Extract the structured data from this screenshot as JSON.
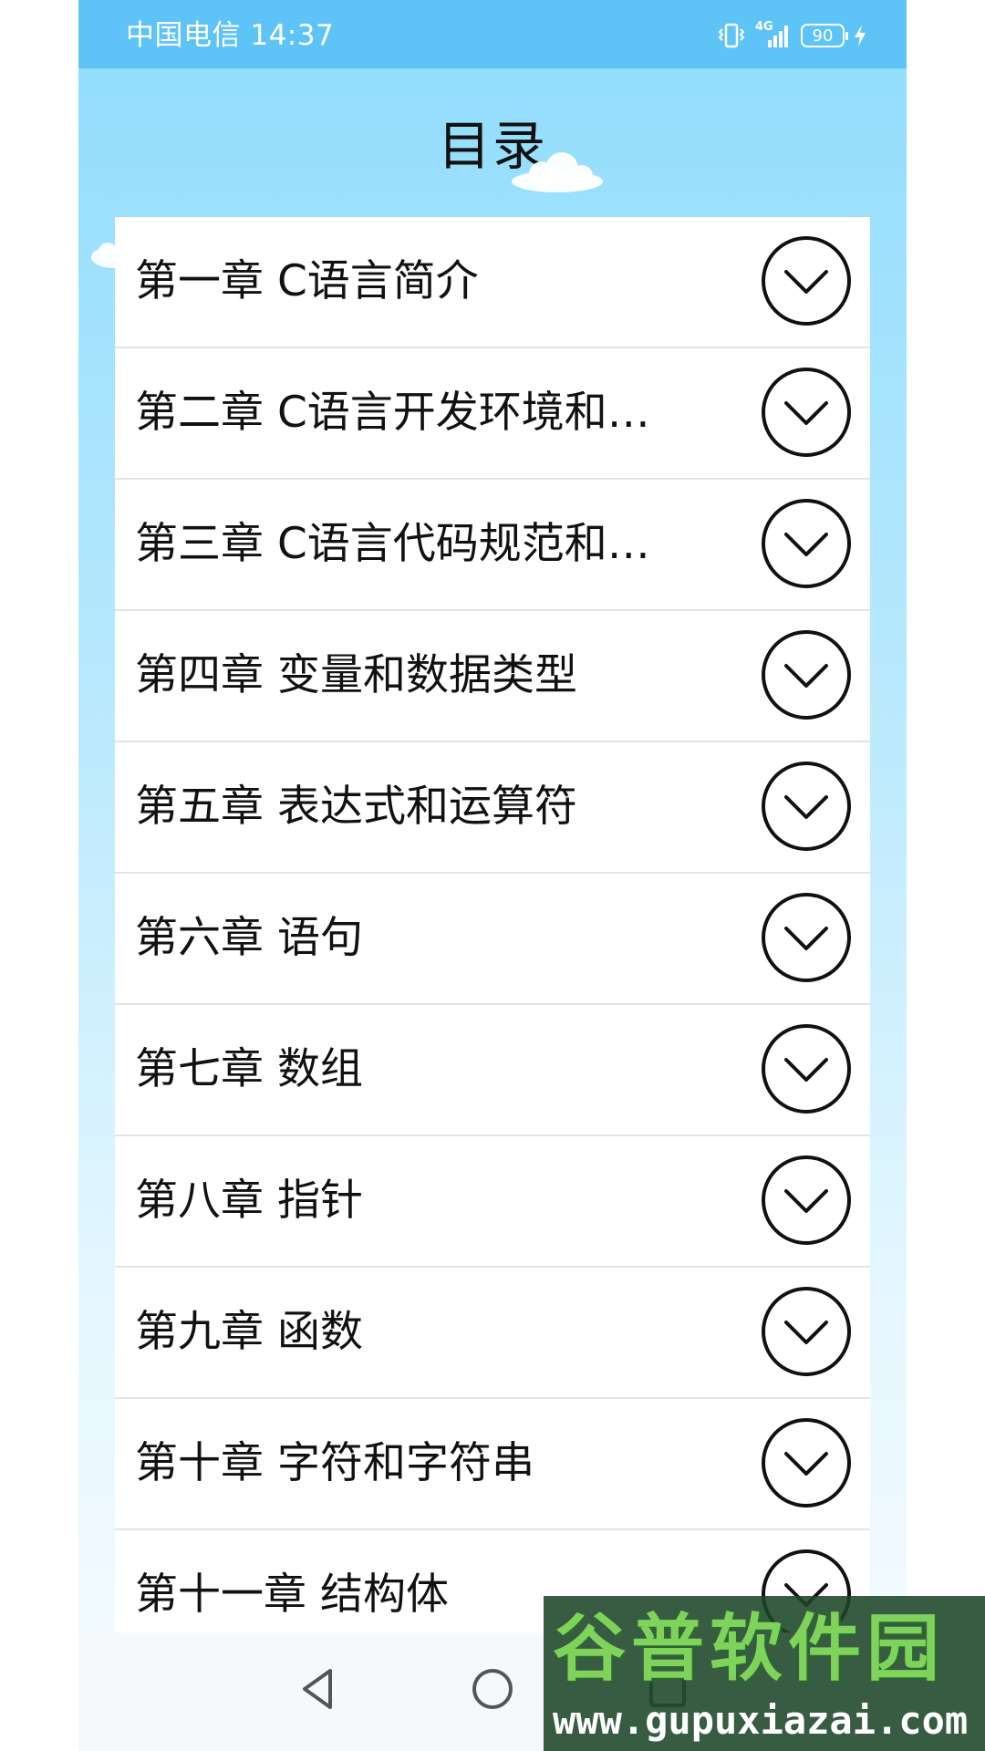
{
  "status_bar": {
    "carrier_time": "中国电信 14:37",
    "network": "4G",
    "battery": "90"
  },
  "header": {
    "title": "目录"
  },
  "toc": {
    "items": [
      {
        "label": "第一章 C语言简介"
      },
      {
        "label": "第二章 C语言开发环境和…"
      },
      {
        "label": "第三章 C语言代码规范和…"
      },
      {
        "label": "第四章 变量和数据类型"
      },
      {
        "label": "第五章 表达式和运算符"
      },
      {
        "label": "第六章 语句"
      },
      {
        "label": "第七章 数组"
      },
      {
        "label": "第八章 指针"
      },
      {
        "label": "第九章 函数"
      },
      {
        "label": "第十章 字符和字符串"
      },
      {
        "label": "第十一章 结构体"
      }
    ],
    "expand_icon": "chevron-down-circle-icon"
  },
  "watermark": {
    "logo": "谷普软件园",
    "url": "www.gupuxiazai.com"
  },
  "colors": {
    "status_bar": "#5ec3f6",
    "sky_top": "#8fdcfd",
    "text": "#111111",
    "divider": "#e4e4e4"
  }
}
